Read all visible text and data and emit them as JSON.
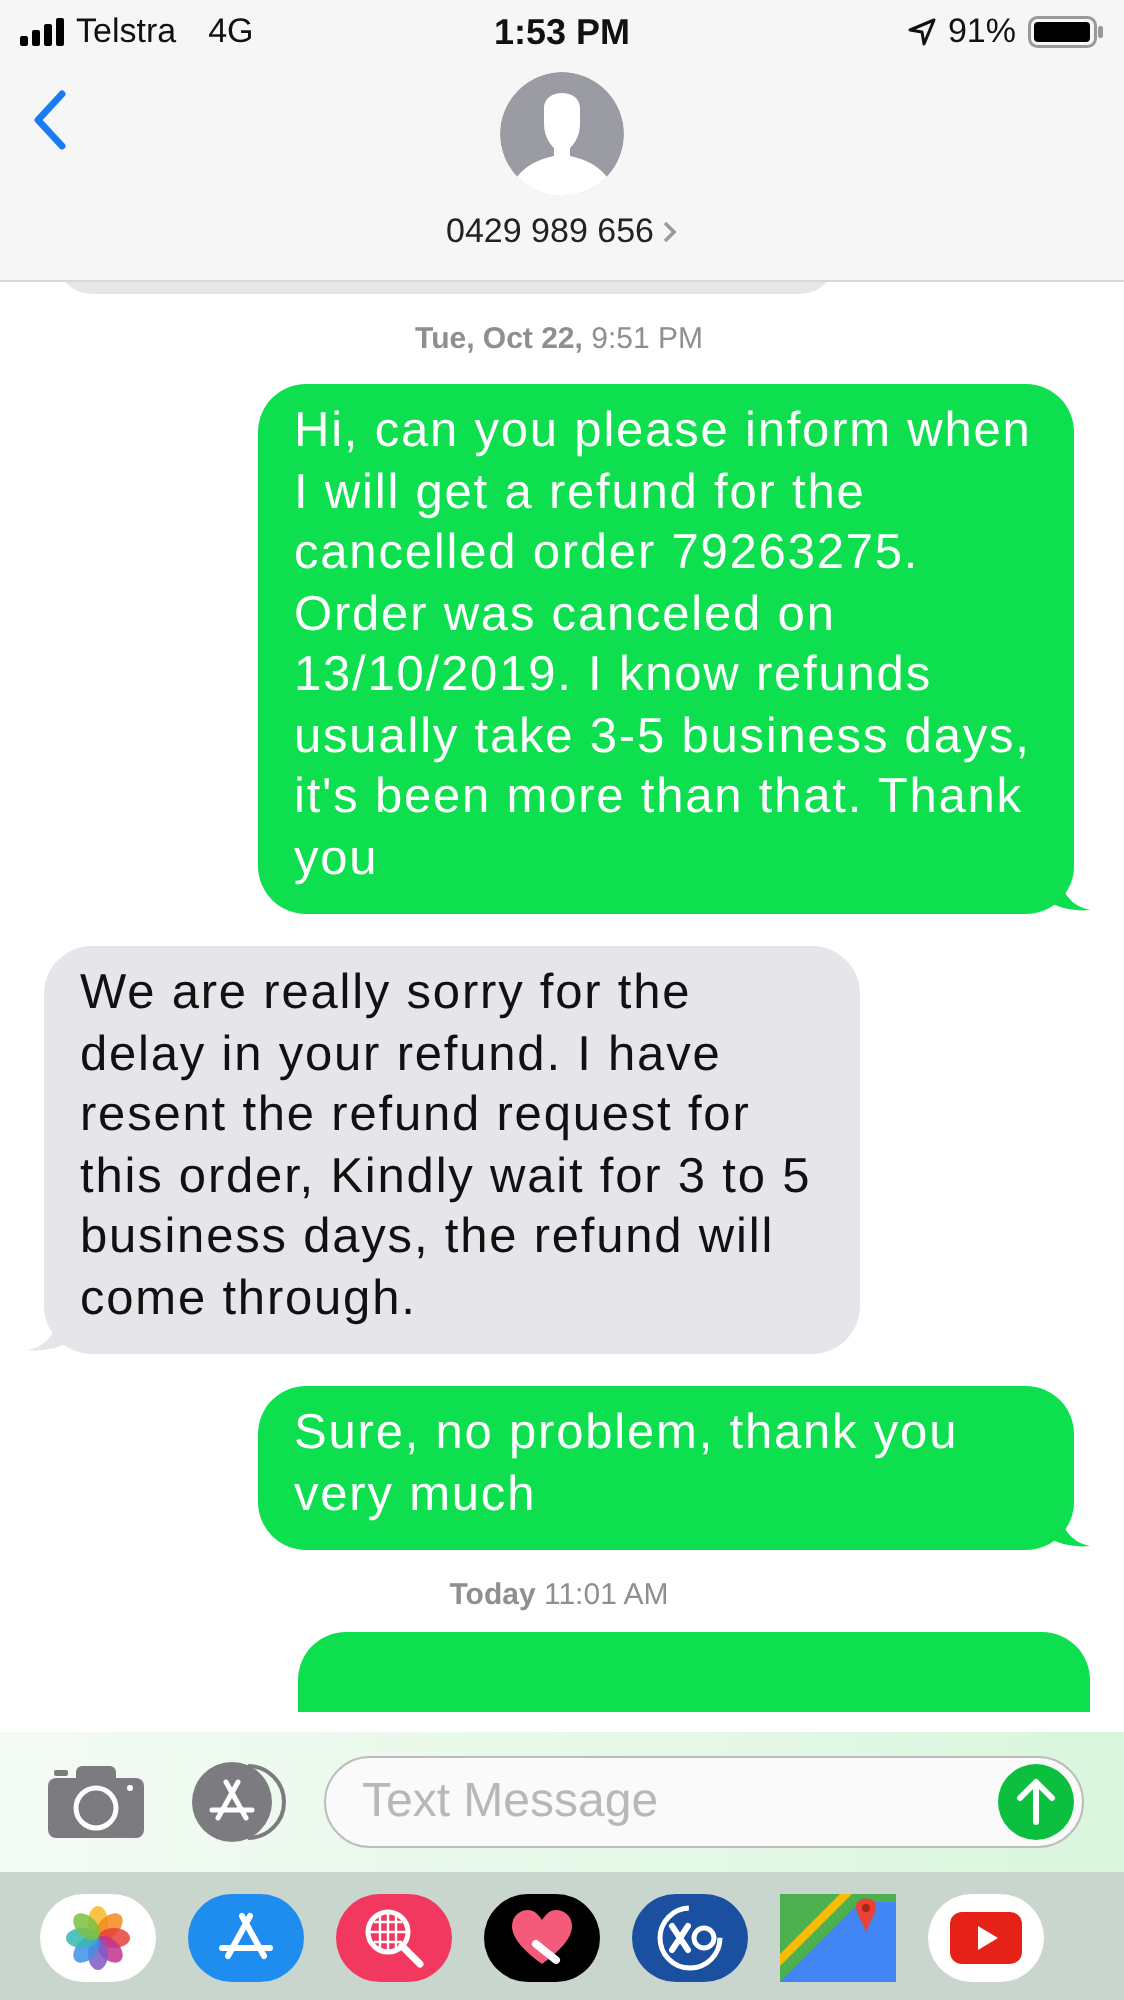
{
  "status_bar": {
    "carrier": "Telstra",
    "network": "4G",
    "time": "1:53 PM",
    "battery": "91%"
  },
  "header": {
    "contact": "0429 989 656"
  },
  "messages": [
    {
      "kind": "received_partial"
    },
    {
      "kind": "timestamp",
      "day": "Tue, Oct 22,",
      "time": "9:51 PM"
    },
    {
      "kind": "sent",
      "text": "Hi, can you please inform when I will get a refund for the cancelled order 79263275. Order was canceled on 13/10/2019. I know refunds usually take 3-5 business days, it's been more than that. Thank you"
    },
    {
      "kind": "received",
      "text": "We are really sorry for the delay in your refund. I have resent the refund request for this order, Kindly wait for 3 to 5 business days,  the refund will come through."
    },
    {
      "kind": "sent",
      "text": "Sure, no problem, thank you very much"
    },
    {
      "kind": "timestamp",
      "day": "Today",
      "time": "11:01 AM"
    },
    {
      "kind": "sent_partial"
    }
  ],
  "composer": {
    "placeholder": "Text Message"
  }
}
